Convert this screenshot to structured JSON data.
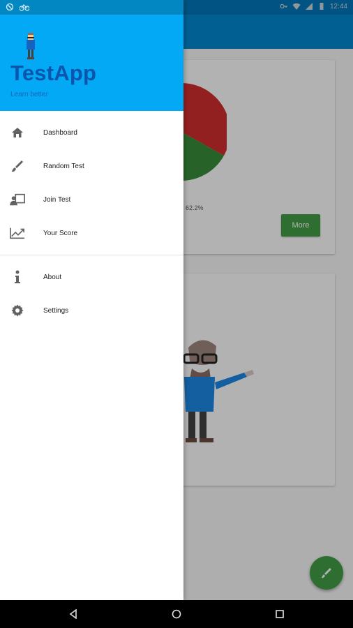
{
  "drawer": {
    "app_title": "TestApp",
    "app_subtitle": "Learn better",
    "menu_primary": [
      {
        "label": "Dashboard",
        "icon": "home-icon"
      },
      {
        "label": "Random Test",
        "icon": "brush-icon"
      },
      {
        "label": "Join Test",
        "icon": "presenter-icon"
      },
      {
        "label": "Your Score",
        "icon": "trending-up-icon"
      }
    ],
    "menu_secondary": [
      {
        "label": "About",
        "icon": "info-icon"
      },
      {
        "label": "Settings",
        "icon": "gear-icon"
      }
    ]
  },
  "main": {
    "pie_label": "62.2%",
    "more_label": "More"
  },
  "status_bar": {
    "time": "12:44"
  },
  "colors": {
    "header": "#03a9f4",
    "appbar": "#0288d1",
    "accent_green": "#43a047",
    "pie_red": "#d32f2f",
    "pie_green": "#388e3c"
  }
}
